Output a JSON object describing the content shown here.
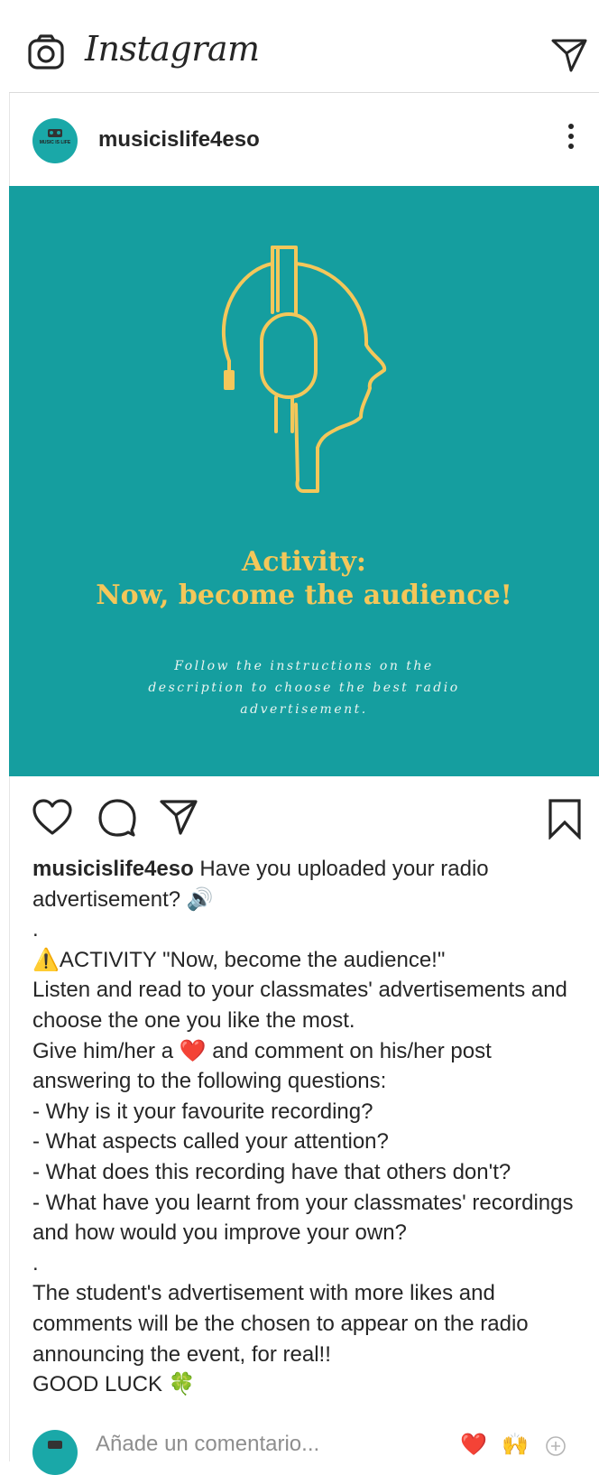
{
  "topbar": {
    "brand": "Instagram",
    "camera_icon": "camera-icon",
    "direct_icon": "paper-plane-icon"
  },
  "post": {
    "username": "musicislife4eso",
    "avatar_text": "MUSIC IS LIFE",
    "more_icon": "more-vertical-icon",
    "image": {
      "title_line1": "Activity:",
      "title_line2": "Now, become the audience!",
      "subtitle": "Follow the instructions on the description to choose the best radio advertisement.",
      "background": "#159e9f",
      "accent": "#f4c75a",
      "icon": "headphones-head-icon"
    }
  },
  "actions": {
    "like_icon": "heart-icon",
    "comment_icon": "comment-icon",
    "share_icon": "paper-plane-icon",
    "save_icon": "bookmark-icon"
  },
  "caption": {
    "username": "musicislife4eso",
    "p1": " Have you uploaded your radio advertisement? 🔊",
    "dot1": ".",
    "p2": "⚠️ACTIVITY \"Now, become the audience!\"\nListen and read to your classmates' advertisements and choose the one you like the most.\nGive him/her a ❤️ and comment on his/her post answering to the following questions:\n- Why is it your favourite recording?\n- What aspects called your attention?\n- What does this recording have that others don't?\n- What have you learnt from your classmates' recordings and how would you improve your own?",
    "dot2": ".",
    "p3": "The student's advertisement with more likes and comments will be the chosen to appear on the radio announcing the event, for real!!\nGOOD LUCK 🍀"
  },
  "comment": {
    "placeholder": "Añade un comentario...",
    "quick_reactions": [
      "❤️",
      "🙌"
    ],
    "add_icon": "plus-circle-icon"
  }
}
